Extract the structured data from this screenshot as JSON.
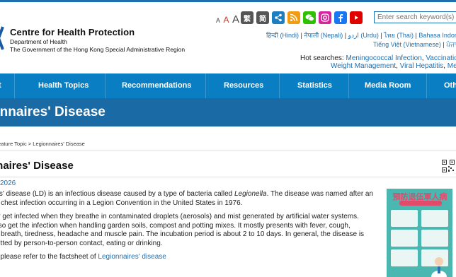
{
  "header": {
    "org_name": "Centre for Health Protection",
    "dept": "Department of Health",
    "gov": "The Government of the Hong Kong Special Administrative Region",
    "font_sizes": [
      "A",
      "A",
      "A"
    ],
    "lang_buttons": [
      "繁",
      "简"
    ],
    "search_placeholder": "Enter search keyword(s)",
    "languages_row1": [
      "हिन्दी (Hindi)",
      "नेपाली (Nepali)",
      "اردو (Urdu)",
      "ไทย (Thai)",
      "Bahasa Indonesia"
    ],
    "languages_row2": [
      "Tiếng Việt (Vietnamese)",
      "ਪੰਜਾਬੀ"
    ],
    "hot_searches_label": "Hot searches:",
    "hot_searches": [
      "Meningococcal Infection",
      "Vaccination S",
      "Weight Management",
      "Viral Hepatitis",
      "Men"
    ]
  },
  "nav": {
    "items": [
      "t",
      "Health Topics",
      "Recommendations",
      "Resources",
      "Statistics",
      "Media Room",
      "Oth"
    ]
  },
  "banner": {
    "title": "onnaires' Disease"
  },
  "breadcrumb": {
    "parent": "eature Topic >",
    "current": "Legionnaires' Disease"
  },
  "page": {
    "title": "nnaires' Disease",
    "date": "2026",
    "p1_a": "res' disease (LD) is an infectious disease caused by a type of bacteria called ",
    "p1_em": "Legionella",
    "p1_b": ". The disease was named after an",
    "p1_line2": "of chest infection occurring in a Legion Convention in the United States in 1976.",
    "p2_line1": "ay get infected when they breathe in contaminated droplets (aerosols) and mist generated by artificial water systems.",
    "p2_line2": "also get the infection when handling garden soils, compost and potting mixes. It mostly presents with fever, cough,",
    "p2_line3": "of breath, tiredness, headache and muscle pain. The incubation period is about 2 to 10 days. In general, the disease is",
    "p2_line4": "mitted by person-to-person contact, eating or drinking.",
    "p3_a": "s, please refer to the factsheet of ",
    "p3_link": "Legionnaires' disease"
  },
  "poster": {
    "title": "預防退伍軍人病",
    "subtitle": "Prevention of Legionnaires' Disease"
  },
  "colors": {
    "nav": "#0a7ec2",
    "banner": "#1a6aa5",
    "link": "#1e6fb0"
  },
  "icon_names": [
    "share-icon",
    "rss-icon",
    "wechat-icon",
    "instagram-icon",
    "facebook-icon",
    "youtube-icon"
  ]
}
